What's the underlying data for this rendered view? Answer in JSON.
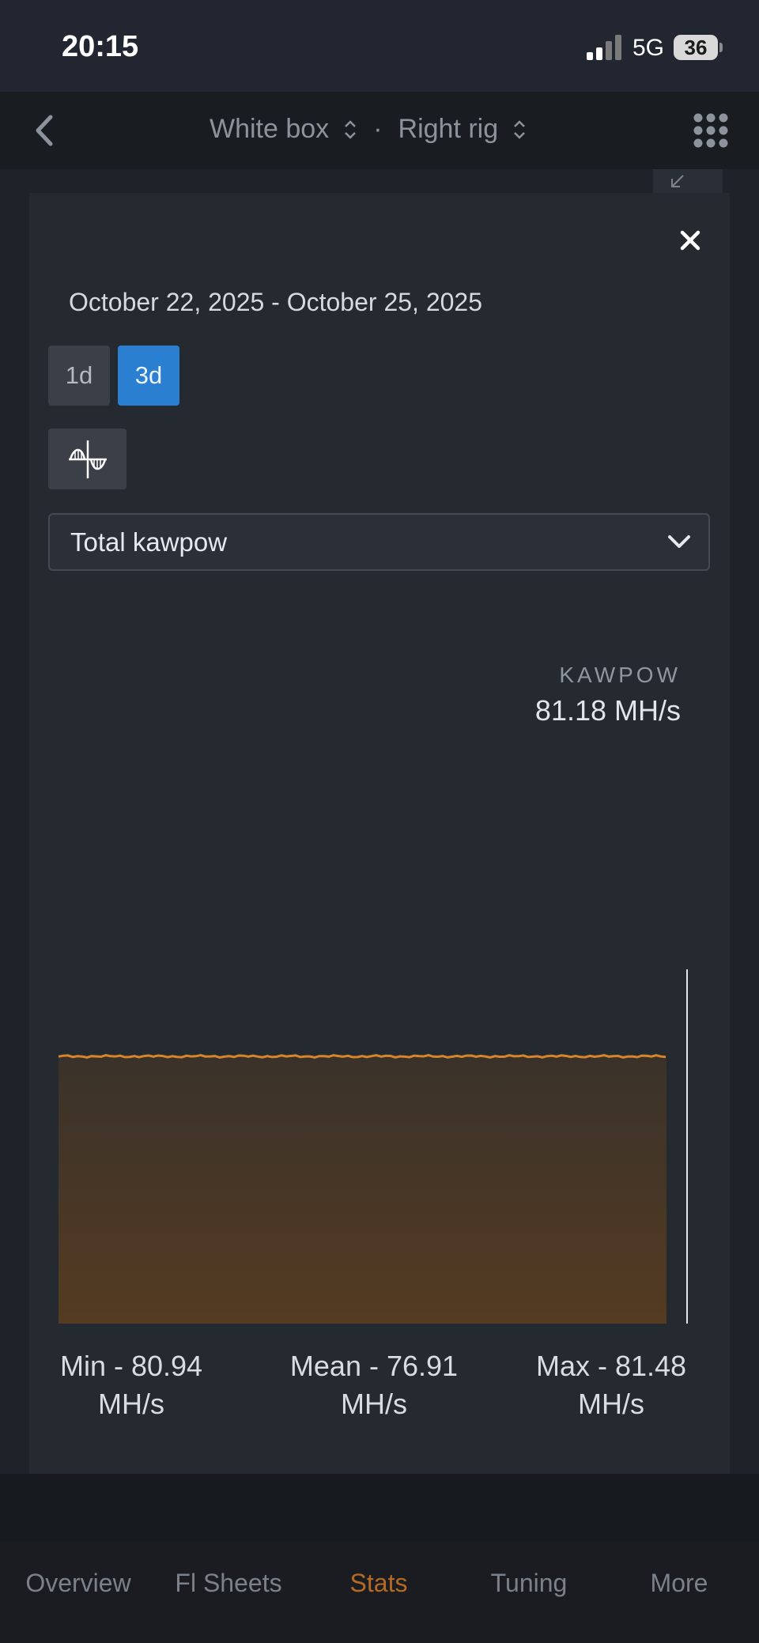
{
  "status_bar": {
    "time": "20:15",
    "network": "5G",
    "battery": "36"
  },
  "nav": {
    "device": "White box",
    "separator": "·",
    "rig": "Right rig"
  },
  "modal": {
    "date_range": "October 22, 2025 - October 25, 2025",
    "ranges": [
      {
        "label": "1d",
        "active": false
      },
      {
        "label": "3d",
        "active": true
      }
    ],
    "metric_select": "Total kawpow",
    "series_name": "KAWPOW",
    "current_value": "81.18 MH/s",
    "stats": {
      "min": {
        "line1": "Min - 80.94",
        "line2": "MH/s"
      },
      "mean": {
        "line1": "Mean - 76.91",
        "line2": "MH/s"
      },
      "max": {
        "line1": "Max - 81.48",
        "line2": "MH/s"
      }
    }
  },
  "chart_data": {
    "type": "area",
    "title": "",
    "series": [
      {
        "name": "KAWPOW",
        "unit": "MH/s",
        "min": 80.94,
        "mean": 76.91,
        "max": 81.48,
        "current": 81.18
      }
    ],
    "colors": {
      "line": "#d5862a",
      "fill_top": "#3a322a",
      "fill_bottom": "#5f3f1e",
      "cursor": "#e5e5e5"
    },
    "grid": false
  },
  "tabs": [
    {
      "label": "Overview",
      "active": false
    },
    {
      "label": "Fl Sheets",
      "active": false
    },
    {
      "label": "Stats",
      "active": true
    },
    {
      "label": "Tuning",
      "active": false
    },
    {
      "label": "More",
      "active": false
    }
  ]
}
